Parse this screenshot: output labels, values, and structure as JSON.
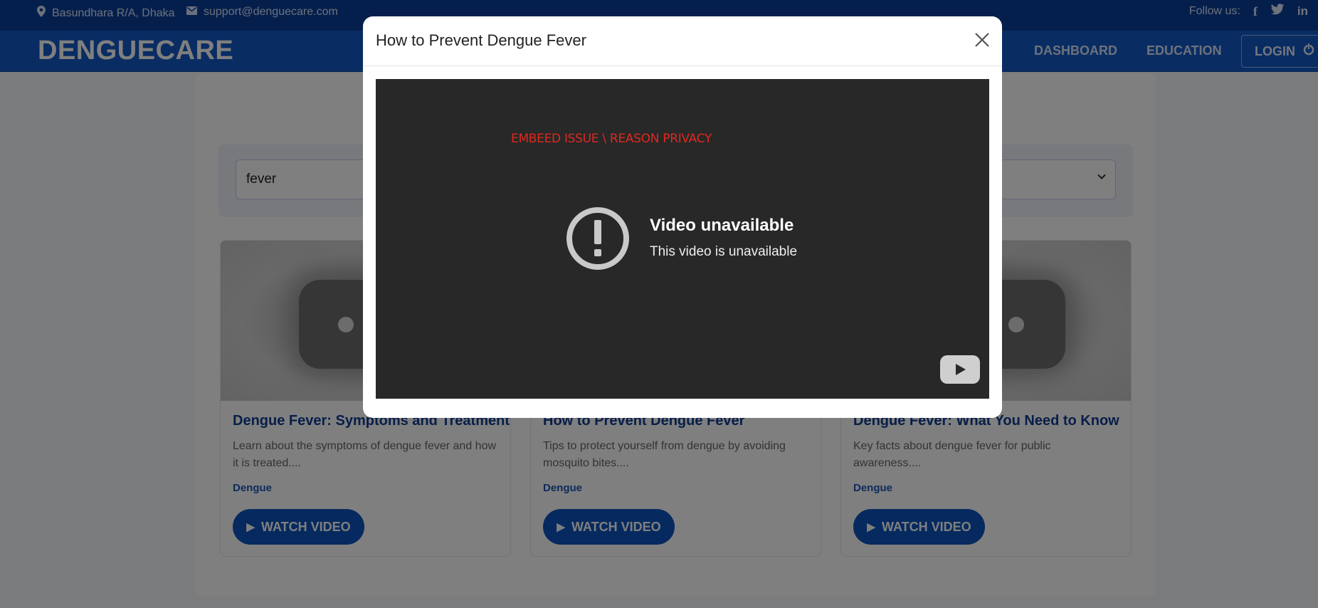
{
  "topbar": {
    "location": "Basundhara R/A, Dhaka",
    "email": "support@denguecare.com",
    "follow_label": "Follow us:",
    "social_icons": [
      "facebook-icon",
      "twitter-icon",
      "linkedin-icon"
    ]
  },
  "navbar": {
    "logo": "DENGUECARE",
    "links": [
      "DASHBOARD",
      "EDUCATION"
    ],
    "login_label": "LOGIN"
  },
  "filters": {
    "search_value": "fever"
  },
  "cards": [
    {
      "title": "Dengue Fever: Symptoms and Treatment",
      "description": "Learn about the symptoms of dengue fever and how it is treated....",
      "tag": "Dengue",
      "button_label": "WATCH VIDEO"
    },
    {
      "title": "How to Prevent Dengue Fever",
      "description": "Tips to protect yourself from dengue by avoiding mosquito bites....",
      "tag": "Dengue",
      "button_label": "WATCH VIDEO"
    },
    {
      "title": "Dengue Fever: What You Need to Know",
      "description": "Key facts about dengue fever for public awareness....",
      "tag": "Dengue",
      "button_label": "WATCH VIDEO"
    }
  ],
  "modal": {
    "title": "How to Prevent Dengue Fever",
    "embed_note": "EMBEED ISSUE \\ REASON PRIVACY",
    "unavailable_title": "Video unavailable",
    "unavailable_subtitle": "This video is unavailable"
  },
  "colors": {
    "topbar": "#0b3f9a",
    "navbar": "#1258c7",
    "accent": "#0c55bf",
    "title_blue": "#103d93",
    "embed_note_red": "#e0281e"
  }
}
